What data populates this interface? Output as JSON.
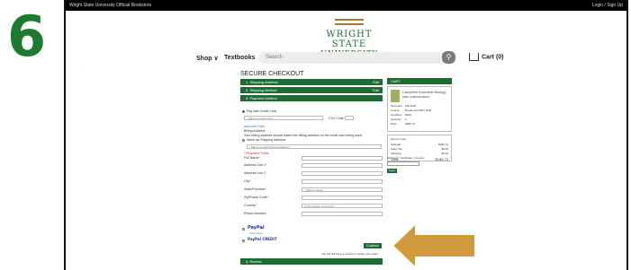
{
  "step_number": "6",
  "topbar": {
    "left": "Wright State University Official Bookstore",
    "right": "Login / Sign Up"
  },
  "logo": {
    "line1": "WRIGHT STATE",
    "line2": "UNIVERSITY"
  },
  "nav": {
    "shop": "Shop",
    "textbooks": "Textbooks",
    "search_placeholder": "Search",
    "cart": "Cart (0)"
  },
  "checkout": {
    "title": "SECURE CHECKOUT",
    "steps": [
      {
        "label": "1. Shipping Address",
        "edit": "Edit"
      },
      {
        "label": "2. Shipping Method",
        "edit": "Edit"
      },
      {
        "label": "3. Payment Method",
        "edit": ""
      }
    ],
    "payment": {
      "pay_with_card": "Pay with Credit Card",
      "select_card": "- Select a Credit Card -",
      "cvv": "CVV Code (?)",
      "add_new_card": "Add new Card",
      "billing_address": "Billing Address",
      "billing_note": "Your billing address should match the billing address on the credit card being used.",
      "same_as_shipping": "Same as Shipping Address",
      "select_prev": "- Select to Use Previous Address -",
      "required_note": "* Required Fields",
      "fields": [
        {
          "label": "Full Name",
          "req": "*",
          "value": ""
        },
        {
          "label": "Address Line 1",
          "req": "*",
          "value": ""
        },
        {
          "label": "Address Line 2",
          "req": "",
          "value": ""
        },
        {
          "label": "City",
          "req": "*",
          "value": ""
        },
        {
          "label": "State/Province",
          "req": "*",
          "value": "- Select a State -"
        },
        {
          "label": "Zip/Postal Code",
          "req": "*",
          "value": ""
        },
        {
          "label": "Country",
          "req": "*",
          "value": "United States of America"
        },
        {
          "label": "Phone Number",
          "req": "*",
          "value": ""
        }
      ],
      "paypal": "PayPal",
      "paypal_sub": "Learn More",
      "paypal_credit": "PayPal CREDIT",
      "continue": "Continue",
      "continue_note": "You will still have a chance to review your order.",
      "review": "4. Review"
    }
  },
  "cart_summary": {
    "header": "CART",
    "item": {
      "title": "Campbell Essential Biology",
      "isbn": "ISBN: 9780134765037",
      "rows": [
        {
          "k": "Semester",
          "v": "Fall 2020"
        },
        {
          "k": "Course",
          "v": "Department BIO 1000"
        },
        {
          "k": "Condition",
          "v": "NEW"
        },
        {
          "k": "Quantity",
          "v": "1"
        },
        {
          "k": "Price",
          "v": "$186.72"
        }
      ]
    },
    "totals": {
      "items": "Items in Cart",
      "subtotal_label": "Subtotal",
      "subtotal": "$186.72",
      "tax_label": "Sales Tax",
      "tax": "$0.00",
      "shipping_label": "Shipping",
      "shipping": "$0.00",
      "total_label": "Total",
      "total": "$186.72"
    },
    "gift_card_label": "Gift Card / Certificate / Coupon",
    "apply": "Apply"
  },
  "colors": {
    "green": "#1e6b34",
    "arrow": "#d19a3c"
  }
}
